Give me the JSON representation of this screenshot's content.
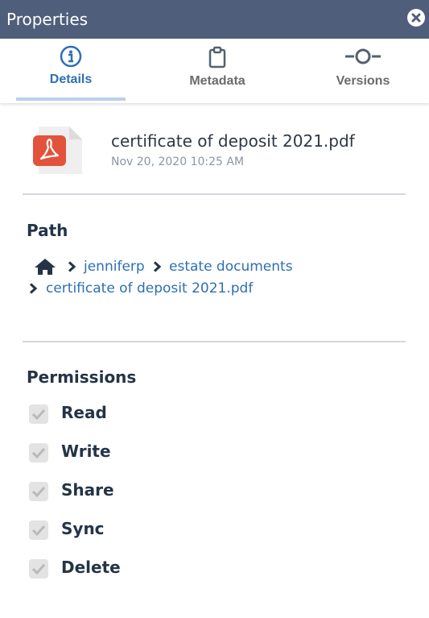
{
  "window": {
    "title": "Properties",
    "close_icon": "close-circle-icon"
  },
  "tabs": [
    {
      "label": "Details",
      "icon": "info-circle-icon",
      "active": true
    },
    {
      "label": "Metadata",
      "icon": "clipboard-icon",
      "active": false
    },
    {
      "label": "Versions",
      "icon": "version-timeline-icon",
      "active": false
    }
  ],
  "file": {
    "name": "certificate of deposit 2021.pdf",
    "date": "Nov 20, 2020 10:25 AM",
    "icon": "pdf-file-icon"
  },
  "path": {
    "heading": "Path",
    "home_icon": "home-icon",
    "crumbs": [
      "jenniferp",
      "estate documents",
      "certificate of deposit 2021.pdf"
    ]
  },
  "permissions": {
    "heading": "Permissions",
    "items": [
      {
        "label": "Read",
        "checked": true
      },
      {
        "label": "Write",
        "checked": true
      },
      {
        "label": "Share",
        "checked": true
      },
      {
        "label": "Sync",
        "checked": true
      },
      {
        "label": "Delete",
        "checked": true
      }
    ]
  },
  "colors": {
    "titlebar": "#4f5e7a",
    "accent": "#2d6fb5",
    "pdf_red": "#e2533b"
  }
}
